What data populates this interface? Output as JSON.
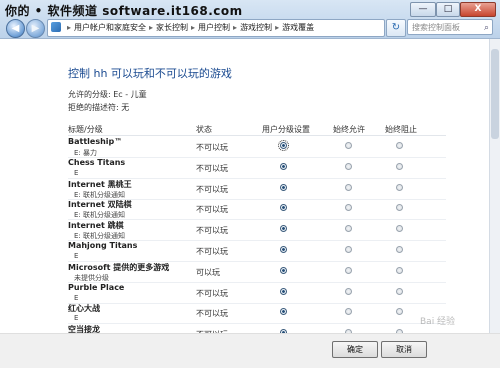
{
  "watermark": "你的 • 软件频道 software.it168.com",
  "window_controls": {
    "minimize": "—",
    "maximize": "□",
    "close": "X"
  },
  "address": {
    "segments": [
      "用户帐户和家庭安全",
      "家长控制",
      "用户控制",
      "游戏控制",
      "游戏覆盖"
    ],
    "separator": "▸"
  },
  "search": {
    "placeholder": "搜索控制面板"
  },
  "page": {
    "title": "控制 hh 可以玩和不可以玩的游戏",
    "allowed_rating": "允许的分级:  Ec - 儿童",
    "blocked_descriptors": "拒绝的描述符:  无"
  },
  "table": {
    "headers": {
      "title": "标题/分级",
      "status": "状态",
      "user_setting": "用户分级设置",
      "always_allow": "始终允许",
      "always_block": "始终阻止"
    },
    "rows": [
      {
        "name": "Battleship™",
        "rating": "E: 暴力",
        "status": "不可以玩",
        "selected": 0
      },
      {
        "name": "Chess Titans",
        "rating": "E",
        "status": "不可以玩",
        "selected": 0
      },
      {
        "name": "Internet 黑桃王",
        "rating": "E: 联机分级通知",
        "status": "不可以玩",
        "selected": 0
      },
      {
        "name": "Internet 双陆棋",
        "rating": "E: 联机分级通知",
        "status": "不可以玩",
        "selected": 0
      },
      {
        "name": "Internet 跳棋",
        "rating": "E: 联机分级通知",
        "status": "不可以玩",
        "selected": 0
      },
      {
        "name": "Mahjong Titans",
        "rating": "E",
        "status": "不可以玩",
        "selected": 0
      },
      {
        "name": "Microsoft 提供的更多游戏",
        "rating": "未提供分级",
        "status": "可以玩",
        "selected": 0
      },
      {
        "name": "Purble Place",
        "rating": "E",
        "status": "不可以玩",
        "selected": 0
      },
      {
        "name": "红心大战",
        "rating": "E",
        "status": "不可以玩",
        "selected": 0
      },
      {
        "name": "空当接龙",
        "rating": "E",
        "status": "不可以玩",
        "selected": 0
      }
    ]
  },
  "buttons": {
    "ok": "确定",
    "cancel": "取消"
  },
  "logo_watermark": "Bai 经验"
}
